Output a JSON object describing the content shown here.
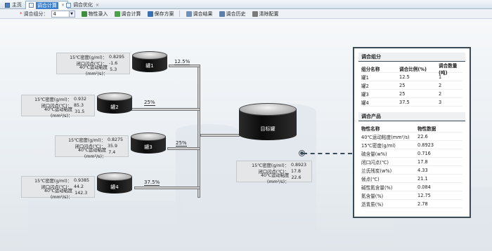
{
  "tabs": [
    {
      "label": "主页"
    },
    {
      "label": "调合计算"
    },
    {
      "label": "调合优化"
    }
  ],
  "toolbar": {
    "group_label": "调合组分：",
    "group_value": "4",
    "buttons": [
      "物性录入",
      "调合计算",
      "保存方案",
      "调合结果",
      "调合历史",
      "清除配置"
    ]
  },
  "tanks": [
    {
      "name": "罐1",
      "ratio": "12.5%",
      "props": [
        {
          "k": "15℃密度(g/ml)：",
          "v": "0.8295"
        },
        {
          "k": "闭口闪点(℃)：",
          "v": "-1.6"
        },
        {
          "k": "40℃运动粘度(mm²/s)：",
          "v": "5.3"
        }
      ]
    },
    {
      "name": "罐2",
      "ratio": "25%",
      "props": [
        {
          "k": "15℃密度(g/ml)：",
          "v": "0.932"
        },
        {
          "k": "闭口闪点(℃)：",
          "v": "85.3"
        },
        {
          "k": "40℃运动粘度(mm²/s)：",
          "v": "31.5"
        }
      ]
    },
    {
      "name": "罐3",
      "ratio": "25%",
      "props": [
        {
          "k": "15℃密度(g/ml)：",
          "v": "0.8275"
        },
        {
          "k": "闭口闪点(℃)：",
          "v": "35.9"
        },
        {
          "k": "40℃运动粘度(mm²/s)：",
          "v": "7.4"
        }
      ]
    },
    {
      "name": "罐4",
      "ratio": "37.5%",
      "props": [
        {
          "k": "15℃密度(g/ml)：",
          "v": "0.9385"
        },
        {
          "k": "闭口闪点(℃)：",
          "v": "44.2"
        },
        {
          "k": "40℃运动粘度(mm²/s)：",
          "v": "142.3"
        }
      ]
    }
  ],
  "target": {
    "name": "目标罐",
    "props": [
      {
        "k": "15℃密度(g/ml)：",
        "v": "0.8923"
      },
      {
        "k": "闭口闪点(℃)：",
        "v": "17.8"
      },
      {
        "k": "40℃运动粘度(mm²/s)：",
        "v": "22.6"
      }
    ]
  },
  "panel": {
    "components_title": "调合组分",
    "components_headers": [
      "组分名称",
      "调合比例(%)",
      "调合数量(吨)"
    ],
    "components": [
      [
        "罐1",
        "12.5",
        "1"
      ],
      [
        "罐2",
        "25",
        "2"
      ],
      [
        "罐3",
        "25",
        "2"
      ],
      [
        "罐4",
        "37.5",
        "3"
      ]
    ],
    "product_title": "调合产品",
    "product_headers": [
      "物性名称",
      "物性数据"
    ],
    "product": [
      [
        "40℃运动粘度(mm²/s)",
        "22.6"
      ],
      [
        "15℃密度(g/ml)",
        "0.8923"
      ],
      [
        "硫含量(w%)",
        "0.716"
      ],
      [
        "闭口闪点(℃)",
        "17.8"
      ],
      [
        "兰氏残炭(w%)",
        "4.33"
      ],
      [
        "倾点(℃)",
        "21.1"
      ],
      [
        "碱性氮含量(%)",
        "0.084"
      ],
      [
        "氮含量(%)",
        "12.75"
      ],
      [
        "沥青质(%)",
        "2.78"
      ]
    ]
  },
  "colors": {
    "accent": "#3e7fcf",
    "panel_border": "#3a4a57",
    "tank_body": "#111111"
  }
}
